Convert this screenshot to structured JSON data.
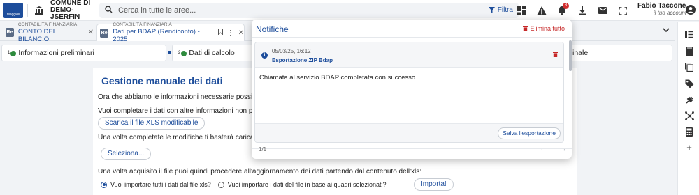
{
  "header": {
    "logo_text": "Maggioli",
    "org_name": "COMUNE DI DEMO-JSERFIN",
    "search_placeholder": "Cerca in tutte le aree...",
    "filter_label": "Filtra",
    "notification_count": "3",
    "user_name": "Fabio Tacconell...",
    "user_role": "il tuo account"
  },
  "tabs": [
    {
      "icon": "Re",
      "category": "CONTABILITÀ FINANZIARIA",
      "title": "CONTO DEL BILANCIO"
    },
    {
      "icon": "Re",
      "category": "CONTABILITÀ FINANZIARIA",
      "title": "Dati per BDAP (Rendiconto) - 2025"
    }
  ],
  "stepper": {
    "steps": [
      {
        "num": "1",
        "label": "Informazioni preliminari"
      },
      {
        "num": "2",
        "label": "Dati di calcolo"
      },
      {
        "label": "inale"
      }
    ]
  },
  "main": {
    "title": "Gestione manuale dei dati",
    "line1": "Ora che abbiamo le informazioni necessarie possiamo p",
    "line2": "Vuoi completare i dati con altre informazioni non preser",
    "download_xls": "Scarica il file XLS modificabile",
    "line3": "Una volta completate le modifiche ti basterà caricare il f",
    "select_file": "Seleziona...",
    "line4": "Una volta acquisito il file puoi quindi procedere all'aggiornamento dei dati partendo dal contenuto dell'xls:",
    "radio_all": "Vuoi importare tutti i dati dal file xls?",
    "radio_some": "Vuoi importare i dati del file in base ai quadri selezionati?",
    "import_button": "Importa!"
  },
  "notifications": {
    "title": "Notifiche",
    "clear_all": "Elimina tutto",
    "items": [
      {
        "timestamp": "05/03/25, 16:12",
        "tag": "Esportazione ZIP Bdap",
        "message": "Chiamata al servizio BDAP completata con successo.",
        "action": "Salva l'esportazione"
      }
    ],
    "pager": "1/1"
  },
  "colors": {
    "primary": "#1d4d9b",
    "danger": "#c62828",
    "success": "#2e8b3d",
    "background": "#f1f3f6"
  }
}
